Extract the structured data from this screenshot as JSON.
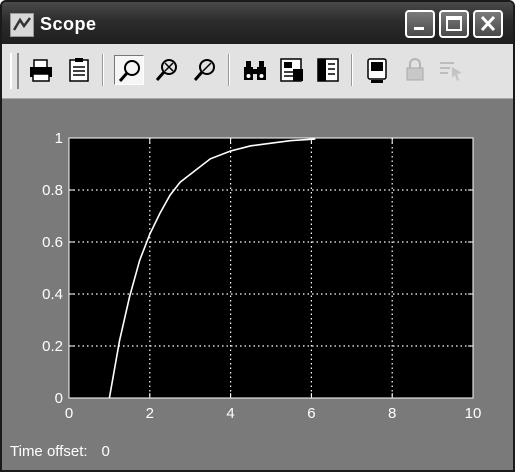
{
  "window": {
    "title": "Scope"
  },
  "toolbar": {
    "buttons": [
      {
        "icon": "print-icon",
        "enabled": true
      },
      {
        "icon": "params-icon",
        "enabled": true
      },
      {
        "icon": "zoom-icon",
        "enabled": true,
        "active": true
      },
      {
        "icon": "zoom-x-icon",
        "enabled": true
      },
      {
        "icon": "zoom-y-icon",
        "enabled": true
      },
      {
        "icon": "autoscale-icon",
        "enabled": true
      },
      {
        "icon": "save-axes-icon",
        "enabled": true
      },
      {
        "icon": "restore-axes-icon",
        "enabled": true
      },
      {
        "icon": "floating-scope-icon",
        "enabled": true
      },
      {
        "icon": "lock-axes-icon",
        "enabled": false
      },
      {
        "icon": "signal-selection-icon",
        "enabled": false
      }
    ]
  },
  "status": {
    "label": "Time offset:",
    "value": "0"
  },
  "chart_data": {
    "type": "line",
    "xlim": [
      0,
      10
    ],
    "ylim": [
      0,
      1
    ],
    "xticks": [
      "0",
      "2",
      "4",
      "6",
      "8",
      "10"
    ],
    "yticks": [
      "0",
      "0.2",
      "0.4",
      "0.6",
      "0.8",
      "1"
    ],
    "grid": true,
    "background": "#000000",
    "series": [
      {
        "color": "#ffffff",
        "x": [
          1,
          1.25,
          1.5,
          1.75,
          2,
          2.25,
          2.5,
          2.75,
          3,
          3.5,
          4,
          4.5,
          5,
          5.5,
          6,
          6.1
        ],
        "y": [
          0,
          0.22,
          0.39,
          0.53,
          0.63,
          0.71,
          0.78,
          0.83,
          0.86,
          0.92,
          0.95,
          0.97,
          0.98,
          0.99,
          0.995,
          0.996
        ]
      }
    ]
  }
}
